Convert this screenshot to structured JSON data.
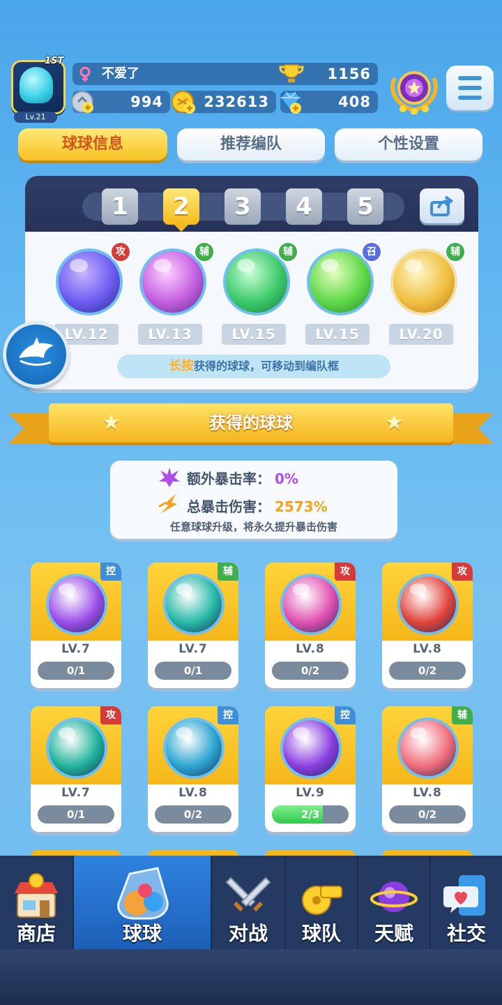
{
  "player": {
    "rank": "1ST",
    "level": "Lv.21",
    "name": "不爱了",
    "trophies": "1156",
    "stamina": "994",
    "coins": "232613",
    "gems": "408"
  },
  "tabs": [
    "球球信息",
    "推荐编队",
    "个性设置"
  ],
  "team": {
    "slots": [
      "1",
      "2",
      "3",
      "4",
      "5"
    ],
    "selected_slot": "2",
    "members": [
      {
        "tag": "攻",
        "level": "LV.12",
        "color": "#6c5cf0"
      },
      {
        "tag": "辅",
        "level": "LV.13",
        "color": "#c35fe0"
      },
      {
        "tag": "辅",
        "level": "LV.15",
        "color": "#3cc96a"
      },
      {
        "tag": "召",
        "level": "LV.15",
        "color": "#5fd84a"
      },
      {
        "tag": "辅",
        "level": "LV.20",
        "color": "#f0c040"
      }
    ],
    "hint_emphasis": "长按",
    "hint_text": "获得的球球，可移动到编队框"
  },
  "section_title": "获得的球球",
  "crit": {
    "extra_label": "额外暴击率：",
    "extra_value": "0%",
    "total_label": "总暴击伤害：",
    "total_value": "2573%",
    "note": "任意球球升级，将永久提升暴击伤害"
  },
  "balls": [
    {
      "tag": "控",
      "level": "LV.7",
      "progress": "0/1",
      "fill": 0,
      "color": "#9a4de8"
    },
    {
      "tag": "辅",
      "level": "LV.7",
      "progress": "0/1",
      "fill": 0,
      "color": "#26b7a6"
    },
    {
      "tag": "攻",
      "level": "LV.8",
      "progress": "0/2",
      "fill": 0,
      "color": "#e04fb0"
    },
    {
      "tag": "攻",
      "level": "LV.8",
      "progress": "0/2",
      "fill": 0,
      "color": "#e0443b"
    },
    {
      "tag": "攻",
      "level": "LV.7",
      "progress": "0/1",
      "fill": 0,
      "color": "#1fb29a"
    },
    {
      "tag": "控",
      "level": "LV.8",
      "progress": "0/2",
      "fill": 0,
      "color": "#2aa4d0"
    },
    {
      "tag": "控",
      "level": "LV.9",
      "progress": "2/3",
      "fill": 0.667,
      "color": "#8a3de0"
    },
    {
      "tag": "辅",
      "level": "LV.8",
      "progress": "0/2",
      "fill": 0,
      "color": "#f06b7a"
    }
  ],
  "nav": [
    "商店",
    "球球",
    "对战",
    "球队",
    "天赋",
    "社交"
  ],
  "nav_active": "球球"
}
